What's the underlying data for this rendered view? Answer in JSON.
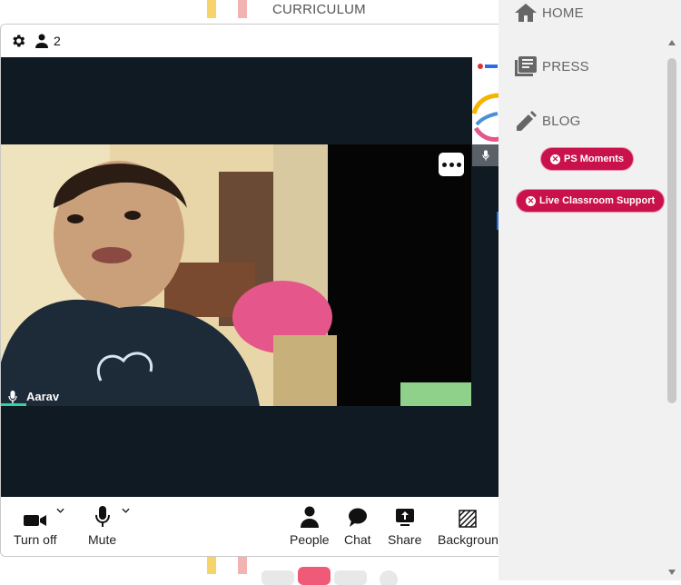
{
  "background": {
    "page_title": "CURRICULUM"
  },
  "meeting": {
    "participant_count": "2",
    "main_participant": {
      "name": "Aarav"
    },
    "toolbar": {
      "camera_label": "Turn off",
      "mute_label": "Mute",
      "people_label": "People",
      "chat_label": "Chat",
      "share_label": "Share",
      "background_label": "Backgroun"
    }
  },
  "side_panel": {
    "nav": [
      {
        "label": "HOME",
        "icon": "home-icon"
      },
      {
        "label": "PRESS",
        "icon": "newspaper-icon"
      },
      {
        "label": "BLOG",
        "icon": "pencil-icon"
      }
    ],
    "badges": [
      {
        "label": "PS Moments"
      },
      {
        "label": "Live Classroom Support"
      }
    ]
  },
  "colors": {
    "video_bg": "#101a22",
    "badge": "#c9114b",
    "speaking": "#2fd7a0",
    "accent": "#2b6de0"
  }
}
